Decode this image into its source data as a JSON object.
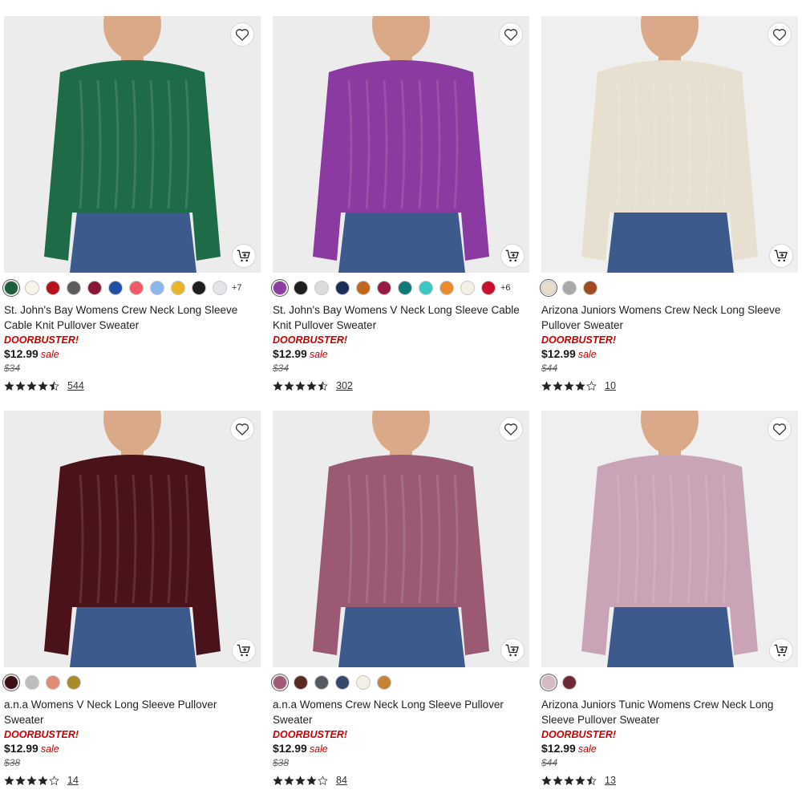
{
  "products": [
    {
      "title": "St. John's Bay Womens Crew Neck Long Sleeve Cable Knit Pullover Sweater",
      "promo": "DOORBUSTER!",
      "price": "$12.99",
      "sale_label": "sale",
      "original_price": "$34",
      "rating": 4.5,
      "review_count": "544",
      "swatches": [
        "#1d5e3c",
        "#f7f4ee",
        "#b5121b",
        "#5c5c5c",
        "#8a1538",
        "#1f4fa8",
        "#ee5b67",
        "#8ab6ea",
        "#e9b62a",
        "#1e1e1e",
        "#e3e5ea"
      ],
      "more_colors": "+7",
      "sweater_color": "#1e6b47",
      "image_bg": "#ececec"
    },
    {
      "title": "St. John's Bay Womens V Neck Long Sleeve Cable Knit Pullover Sweater",
      "promo": "DOORBUSTER!",
      "price": "$12.99",
      "sale_label": "sale",
      "original_price": "$34",
      "rating": 4.5,
      "review_count": "302",
      "swatches": [
        "#8e3ba5",
        "#1e1e1e",
        "#dcdcdc",
        "#1c2d57",
        "#c0671c",
        "#9a1845",
        "#0f7a78",
        "#3cc7c7",
        "#ee8a2e",
        "#f2efe6",
        "#c8102e"
      ],
      "more_colors": "+6",
      "sweater_color": "#8a3aa0",
      "image_bg": "#ececec"
    },
    {
      "title": "Arizona Juniors Womens Crew Neck Long Sleeve Pullover Sweater",
      "promo": "DOORBUSTER!",
      "price": "$12.99",
      "sale_label": "sale",
      "original_price": "$44",
      "rating": 4.0,
      "review_count": "10",
      "swatches": [
        "#e6dccb",
        "#a9a9a9",
        "#a04a22"
      ],
      "more_colors": "",
      "sweater_color": "#e7dfcf",
      "image_bg": "#efefef"
    },
    {
      "title": "a.n.a Womens V Neck Long Sleeve Pullover Sweater",
      "promo": "DOORBUSTER!",
      "price": "$12.99",
      "sale_label": "sale",
      "original_price": "$38",
      "rating": 4.0,
      "review_count": "14",
      "swatches": [
        "#3e0f17",
        "#bdbdbd",
        "#e38a74",
        "#a88a2c"
      ],
      "more_colors": "",
      "sweater_color": "#4a1219",
      "image_bg": "#ececec"
    },
    {
      "title": "a.n.a Womens Crew Neck Long Sleeve Pullover Sweater",
      "promo": "DOORBUSTER!",
      "price": "$12.99",
      "sale_label": "sale",
      "original_price": "$38",
      "rating": 4.0,
      "review_count": "84",
      "swatches": [
        "#a05a78",
        "#5a2a22",
        "#555a60",
        "#36476e",
        "#f4efe4",
        "#c58336"
      ],
      "more_colors": "",
      "sweater_color": "#9a5a74",
      "image_bg": "#ececec"
    },
    {
      "title": "Arizona Juniors Tunic Womens Crew Neck Long Sleeve Pullover Sweater",
      "promo": "DOORBUSTER!",
      "price": "$12.99",
      "sale_label": "sale",
      "original_price": "$44",
      "rating": 4.5,
      "review_count": "13",
      "swatches": [
        "#d7b9c6",
        "#6d2a35"
      ],
      "more_colors": "",
      "sweater_color": "#c9a3b6",
      "image_bg": "#efefef"
    }
  ],
  "icons": {
    "favorite": "heart-outline-icon",
    "add_to_cart": "cart-plus-icon",
    "rating": "star-icon"
  },
  "colors": {
    "promo_red": "#cc0000",
    "text_dark": "#1a1a1a"
  }
}
